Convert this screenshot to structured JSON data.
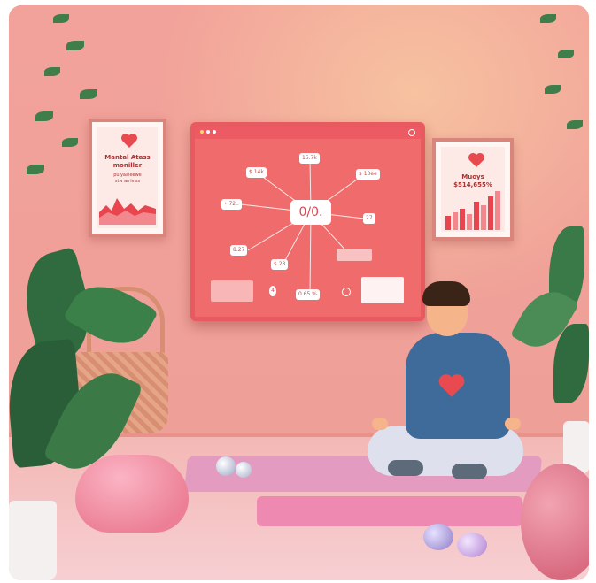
{
  "scene": {
    "description_free": true,
    "left_poster": {
      "title": "Mantal Atass",
      "subtitle": "moniller",
      "lines": [
        "pulyaaleewe",
        "stw arriviss"
      ]
    },
    "right_poster": {
      "title": "Muoys",
      "value": "$514,655%"
    },
    "monitor": {
      "center_value": "0/0.",
      "labels": [
        "15.7k",
        "$ 14k",
        "$ 13ee",
        "• 72..",
        "27",
        "8.27",
        "$ 23",
        "4",
        "0.65 %"
      ]
    }
  },
  "colors": {
    "wall": "#ee9f97",
    "floor": "#f5c4c6",
    "monitor": "#f06c6c",
    "shirt": "#3f6b9a",
    "heart": "#e84a4f",
    "mat": "#e39bc0"
  }
}
